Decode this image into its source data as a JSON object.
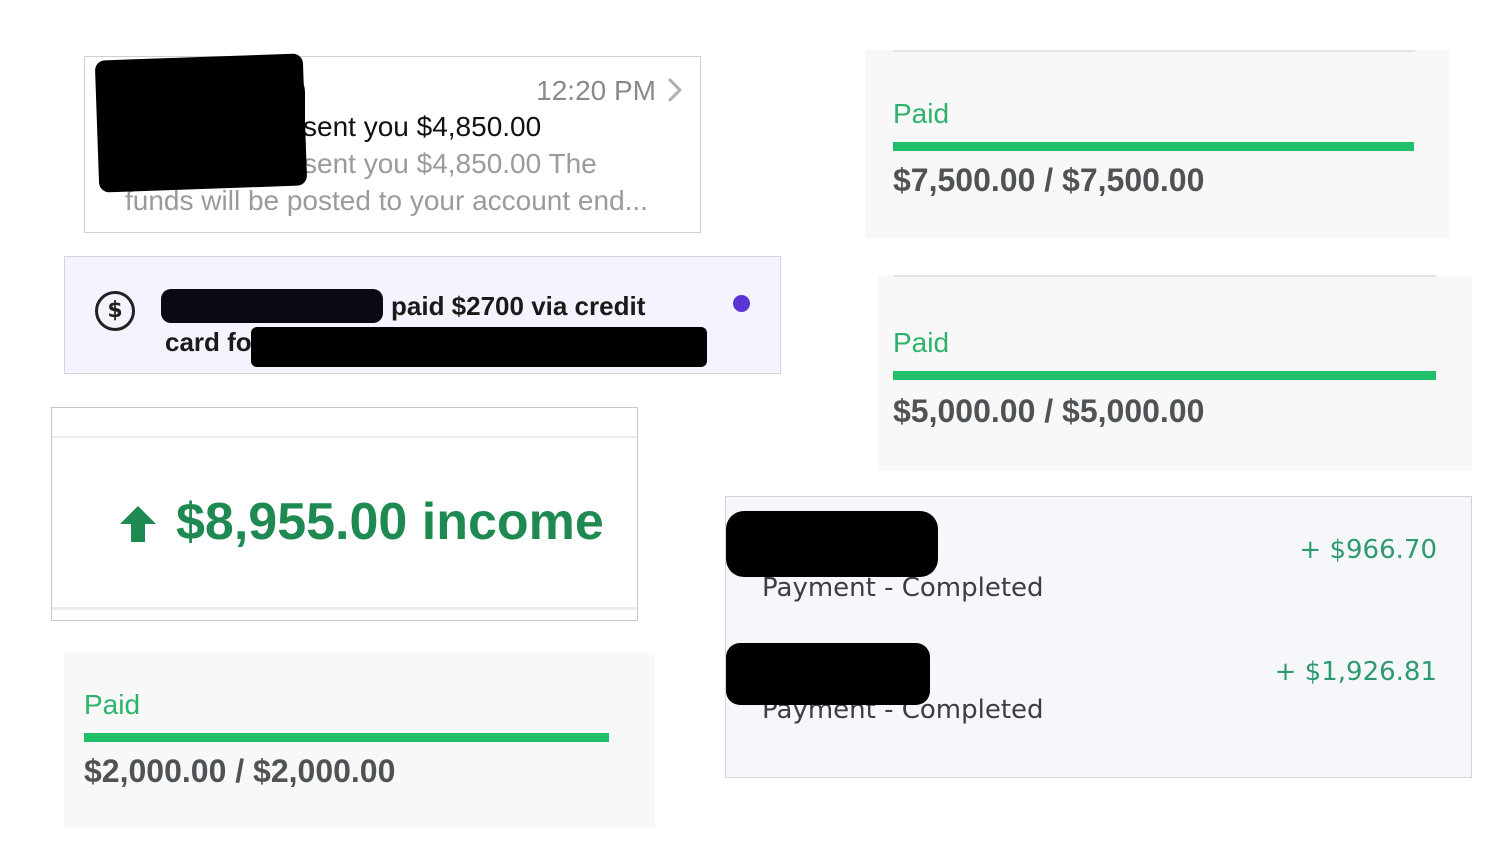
{
  "message": {
    "time": "12:20 PM",
    "line1": "sent you $4,850.00",
    "line2": "sent you $4,850.00 The",
    "line3": "funds will be posted to your account end..."
  },
  "notification": {
    "icon": "dollar-circle-icon",
    "text_line1": "paid $2700 via credit",
    "text_line2": "card fo",
    "unread_color": "#5a34d6"
  },
  "income": {
    "icon": "arrow-up-icon",
    "text": "$8,955.00 income",
    "color": "#1e8a52"
  },
  "paid_cards": [
    {
      "label": "Paid",
      "amounts": "$7,500.00 / $7,500.00",
      "progress": 1.0
    },
    {
      "label": "Paid",
      "amounts": "$5,000.00 / $5,000.00",
      "progress": 1.0
    },
    {
      "label": "Paid",
      "amounts": "$2,000.00 / $2,000.00",
      "progress": 1.0
    }
  ],
  "payments": [
    {
      "description": "Payment - Completed",
      "amount": "+ $966.70"
    },
    {
      "description": "Payment - Completed",
      "amount": "+ $1,926.81"
    }
  ],
  "colors": {
    "paid_green": "#22bf6a",
    "income_green": "#1e8a52",
    "payment_green": "#2e9a6e"
  }
}
